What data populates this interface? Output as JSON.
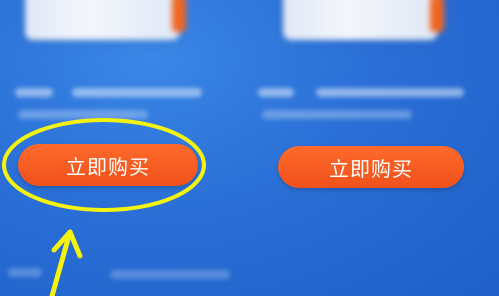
{
  "products": [
    {
      "buy_label": "立即购买"
    },
    {
      "buy_label": "立即购买"
    }
  ],
  "colors": {
    "background": "#2a6fd6",
    "button": "#f0511b",
    "highlight": "#f4f20f"
  }
}
